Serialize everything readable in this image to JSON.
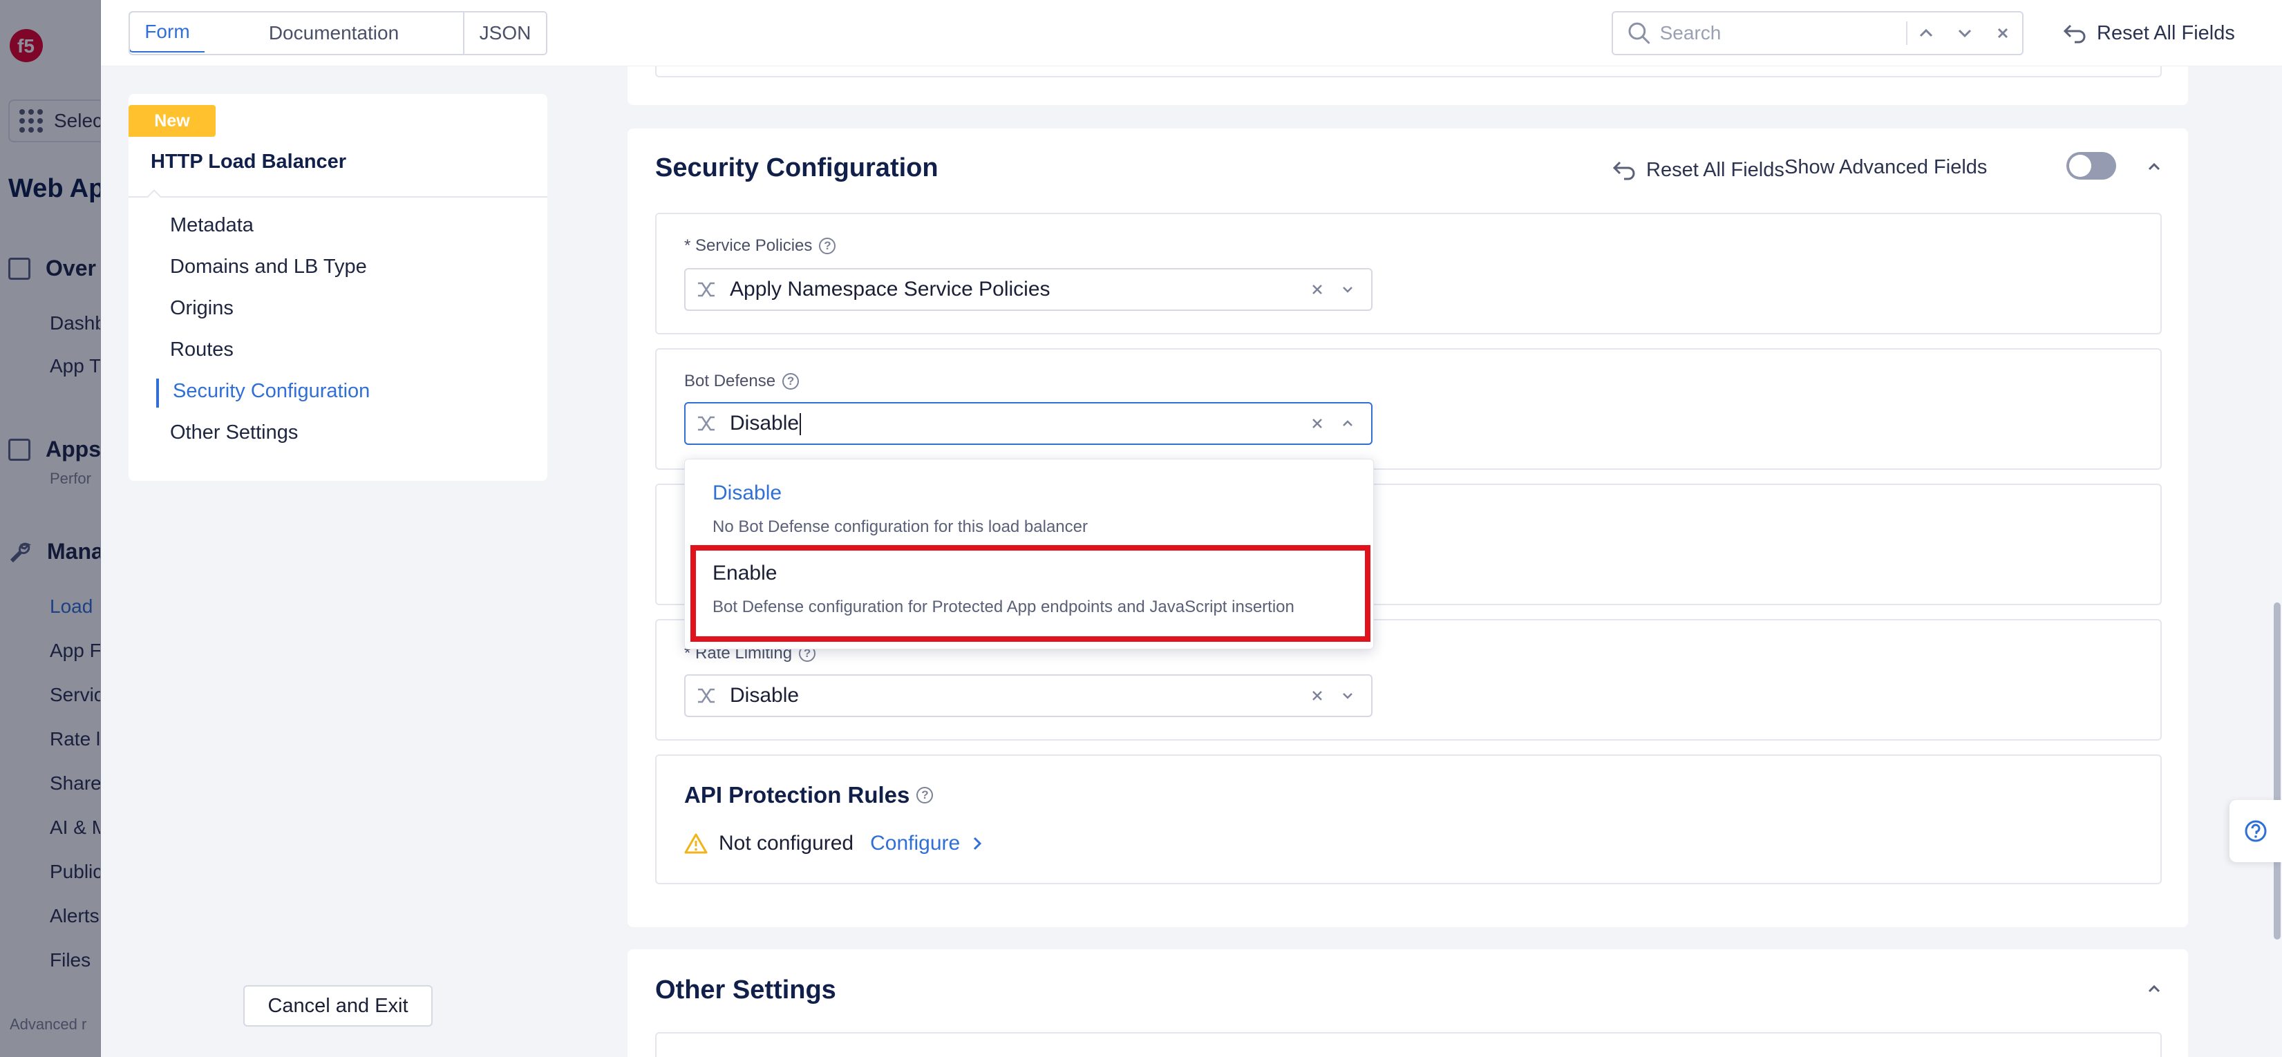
{
  "background_nav": {
    "workspace_label": "Selec",
    "title": "Web Ap",
    "sections": [
      {
        "label": "Over"
      },
      {
        "label": "Apps",
        "sub": "Perfor"
      },
      {
        "label": "Mana"
      }
    ],
    "items_overview": [
      "Dashb",
      "App T"
    ],
    "items_manage": [
      "Load",
      "App F",
      "Servic",
      "Rate l",
      "Share",
      "AI & M",
      "Public",
      "Alerts",
      "Files"
    ],
    "footer": "Advanced r"
  },
  "topbar": {
    "tabs": [
      {
        "label": "Form",
        "active": true
      },
      {
        "label": "Documentation",
        "active": false
      },
      {
        "label": "JSON",
        "active": false
      }
    ],
    "search_placeholder": "Search",
    "reset_all_label": "Reset All Fields"
  },
  "toc": {
    "badge": "New",
    "title": "HTTP Load Balancer",
    "items": [
      {
        "label": "Metadata",
        "active": false
      },
      {
        "label": "Domains and LB Type",
        "active": false
      },
      {
        "label": "Origins",
        "active": false
      },
      {
        "label": "Routes",
        "active": false
      },
      {
        "label": "Security Configuration",
        "active": true
      },
      {
        "label": "Other Settings",
        "active": false
      }
    ]
  },
  "cancel_label": "Cancel and Exit",
  "security": {
    "title": "Security Configuration",
    "reset_label": "Reset All Fields",
    "show_advanced_label": "Show Advanced Fields",
    "show_advanced_on": false,
    "service_policies": {
      "label": "* Service Policies",
      "value": "Apply Namespace Service Policies"
    },
    "bot_defense": {
      "label": "Bot Defense",
      "value": "Disable"
    },
    "rate_limiting": {
      "label": "* Rate Limiting",
      "value": "Disable"
    },
    "api_protection": {
      "title": "API Protection Rules",
      "status": "Not configured",
      "action": "Configure"
    }
  },
  "bot_defense_dropdown": {
    "options": [
      {
        "label": "Disable",
        "description": "No Bot Defense configuration for this load balancer",
        "selected": true,
        "highlighted": false
      },
      {
        "label": "Enable",
        "description": "Bot Defense configuration for Protected App endpoints and JavaScript insertion",
        "selected": false,
        "highlighted": true
      }
    ]
  },
  "other_settings": {
    "title": "Other Settings"
  },
  "colors": {
    "accent": "#2f6fd6",
    "badge": "#ffc12e",
    "highlight_border": "#e0121c",
    "warning": "#f2b31b",
    "heading": "#10204a"
  }
}
